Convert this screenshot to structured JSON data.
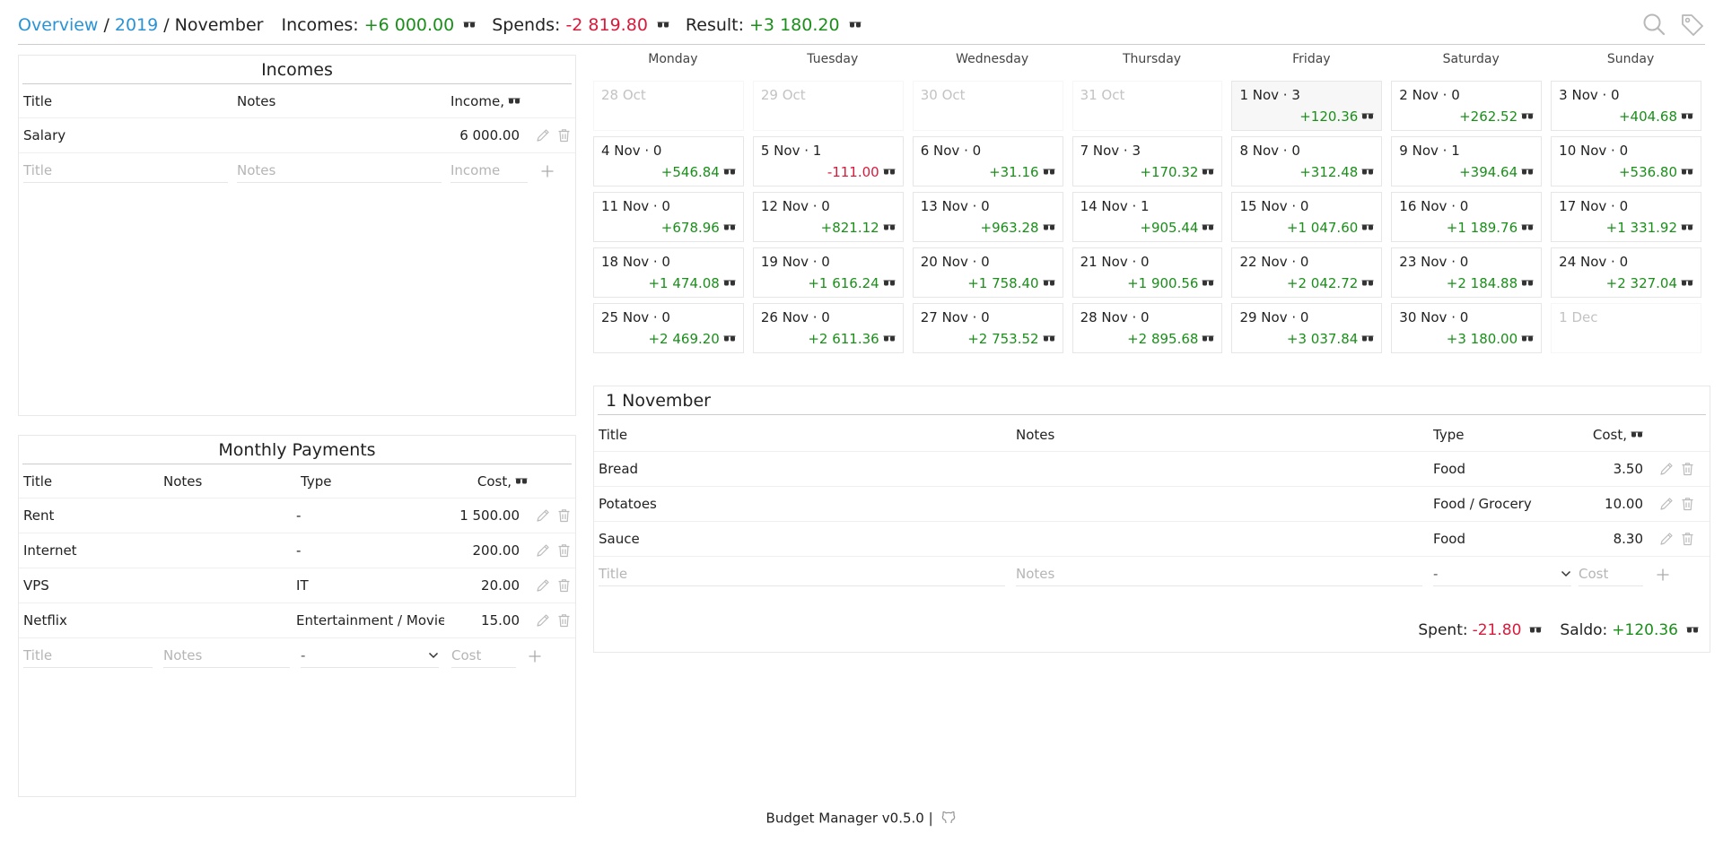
{
  "breadcrumb": {
    "overview": "Overview",
    "year": "2019",
    "month": "November",
    "sep": "/"
  },
  "totals": {
    "incomes_label": "Incomes:",
    "incomes_value": "+6 000.00",
    "spends_label": "Spends:",
    "spends_value": "-2 819.80",
    "result_label": "Result:",
    "result_value": "+3 180.20"
  },
  "incomes": {
    "title": "Incomes",
    "headers": {
      "title": "Title",
      "notes": "Notes",
      "income": "Income,"
    },
    "rows": [
      {
        "title": "Salary",
        "notes": "",
        "income": "6 000.00"
      }
    ],
    "add": {
      "title_ph": "Title",
      "notes_ph": "Notes",
      "income_ph": "Income"
    }
  },
  "monthly": {
    "title": "Monthly Payments",
    "headers": {
      "title": "Title",
      "notes": "Notes",
      "type": "Type",
      "cost": "Cost,"
    },
    "rows": [
      {
        "title": "Rent",
        "notes": "",
        "type": "-",
        "cost": "1 500.00"
      },
      {
        "title": "Internet",
        "notes": "",
        "type": "-",
        "cost": "200.00"
      },
      {
        "title": "VPS",
        "notes": "",
        "type": "IT",
        "cost": "20.00"
      },
      {
        "title": "Netflix",
        "notes": "",
        "type": "Entertainment / Movies",
        "cost": "15.00"
      }
    ],
    "add": {
      "title_ph": "Title",
      "notes_ph": "Notes",
      "type_value": "-",
      "cost_ph": "Cost"
    }
  },
  "calendar": {
    "weekdays": [
      "Monday",
      "Tuesday",
      "Wednesday",
      "Thursday",
      "Friday",
      "Saturday",
      "Sunday"
    ],
    "weeks": [
      [
        {
          "label": "28 Oct",
          "empty": true
        },
        {
          "label": "29 Oct",
          "empty": true
        },
        {
          "label": "30 Oct",
          "empty": true
        },
        {
          "label": "31 Oct",
          "empty": true
        },
        {
          "label": "1 Nov · 3",
          "value": "+120.36",
          "sign": "pos",
          "selected": true
        },
        {
          "label": "2 Nov · 0",
          "value": "+262.52",
          "sign": "pos"
        },
        {
          "label": "3 Nov · 0",
          "value": "+404.68",
          "sign": "pos"
        }
      ],
      [
        {
          "label": "4 Nov · 0",
          "value": "+546.84",
          "sign": "pos"
        },
        {
          "label": "5 Nov · 1",
          "value": "-111.00",
          "sign": "neg"
        },
        {
          "label": "6 Nov · 0",
          "value": "+31.16",
          "sign": "pos"
        },
        {
          "label": "7 Nov · 3",
          "value": "+170.32",
          "sign": "pos"
        },
        {
          "label": "8 Nov · 0",
          "value": "+312.48",
          "sign": "pos"
        },
        {
          "label": "9 Nov · 1",
          "value": "+394.64",
          "sign": "pos"
        },
        {
          "label": "10 Nov · 0",
          "value": "+536.80",
          "sign": "pos"
        }
      ],
      [
        {
          "label": "11 Nov · 0",
          "value": "+678.96",
          "sign": "pos"
        },
        {
          "label": "12 Nov · 0",
          "value": "+821.12",
          "sign": "pos"
        },
        {
          "label": "13 Nov · 0",
          "value": "+963.28",
          "sign": "pos"
        },
        {
          "label": "14 Nov · 1",
          "value": "+905.44",
          "sign": "pos"
        },
        {
          "label": "15 Nov · 0",
          "value": "+1 047.60",
          "sign": "pos"
        },
        {
          "label": "16 Nov · 0",
          "value": "+1 189.76",
          "sign": "pos"
        },
        {
          "label": "17 Nov · 0",
          "value": "+1 331.92",
          "sign": "pos"
        }
      ],
      [
        {
          "label": "18 Nov · 0",
          "value": "+1 474.08",
          "sign": "pos"
        },
        {
          "label": "19 Nov · 0",
          "value": "+1 616.24",
          "sign": "pos"
        },
        {
          "label": "20 Nov · 0",
          "value": "+1 758.40",
          "sign": "pos"
        },
        {
          "label": "21 Nov · 0",
          "value": "+1 900.56",
          "sign": "pos"
        },
        {
          "label": "22 Nov · 0",
          "value": "+2 042.72",
          "sign": "pos"
        },
        {
          "label": "23 Nov · 0",
          "value": "+2 184.88",
          "sign": "pos"
        },
        {
          "label": "24 Nov · 0",
          "value": "+2 327.04",
          "sign": "pos"
        }
      ],
      [
        {
          "label": "25 Nov · 0",
          "value": "+2 469.20",
          "sign": "pos"
        },
        {
          "label": "26 Nov · 0",
          "value": "+2 611.36",
          "sign": "pos"
        },
        {
          "label": "27 Nov · 0",
          "value": "+2 753.52",
          "sign": "pos"
        },
        {
          "label": "28 Nov · 0",
          "value": "+2 895.68",
          "sign": "pos"
        },
        {
          "label": "29 Nov · 0",
          "value": "+3 037.84",
          "sign": "pos"
        },
        {
          "label": "30 Nov · 0",
          "value": "+3 180.00",
          "sign": "pos"
        },
        {
          "label": "1 Dec",
          "empty": true
        }
      ]
    ]
  },
  "day_detail": {
    "title": "1 November",
    "headers": {
      "title": "Title",
      "notes": "Notes",
      "type": "Type",
      "cost": "Cost,"
    },
    "rows": [
      {
        "title": "Bread",
        "notes": "",
        "type": "Food",
        "cost": "3.50"
      },
      {
        "title": "Potatoes",
        "notes": "",
        "type": "Food / Grocery",
        "cost": "10.00"
      },
      {
        "title": "Sauce",
        "notes": "",
        "type": "Food",
        "cost": "8.30"
      }
    ],
    "add": {
      "title_ph": "Title",
      "notes_ph": "Notes",
      "type_value": "-",
      "cost_ph": "Cost"
    },
    "spent_label": "Spent:",
    "spent_value": "-21.80",
    "saldo_label": "Saldo:",
    "saldo_value": "+120.36"
  },
  "footer": {
    "text": "Budget Manager v0.5.0 |"
  },
  "icons": {
    "currency": "sunglasses-icon",
    "search": "search-icon",
    "tag": "tag-icon",
    "edit": "pencil-icon",
    "delete": "trash-icon",
    "add": "plus-icon",
    "github": "github-icon"
  }
}
